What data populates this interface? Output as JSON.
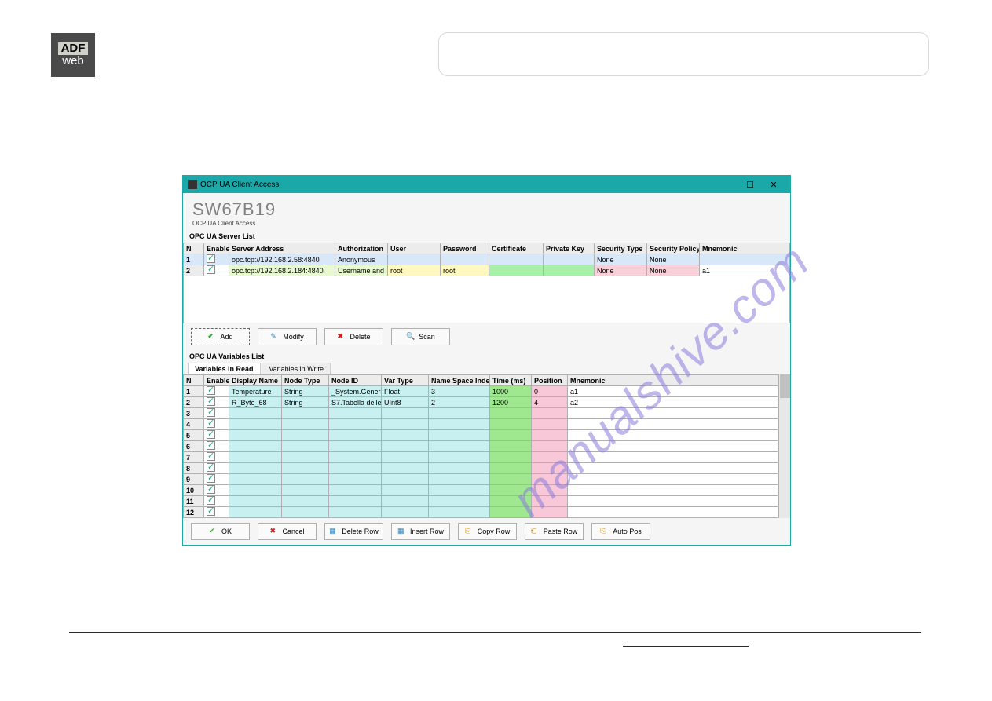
{
  "logo": {
    "top": "ADF",
    "bot": "web"
  },
  "watermark": "manualshive.com",
  "dialog": {
    "titlebar": "OCP UA Client Access",
    "app_title": "SW67B19",
    "app_sub": "OCP UA Client Access",
    "server_section": "OPC UA Server List",
    "vars_section": "OPC UA Variables List",
    "tabs": {
      "read": "Variables in Read",
      "write": "Variables in Write"
    },
    "server_headers": {
      "n": "N",
      "enable": "Enable",
      "address": "Server Address",
      "auth": "Authorization",
      "user": "User",
      "pass": "Password",
      "cert": "Certificate",
      "pkey": "Private Key",
      "sectype": "Security Type",
      "secpol": "Security Policy",
      "mnem": "Mnemonic"
    },
    "server_rows": [
      {
        "n": "1",
        "addr": "opc.tcp://192.168.2.58:4840",
        "auth": "Anonymous",
        "user": "",
        "pass": "",
        "cert": "",
        "pkey": "",
        "st": "None",
        "sp": "None",
        "mnem": ""
      },
      {
        "n": "2",
        "addr": "opc.tcp://192.168.2.184:4840",
        "auth": "Username and",
        "user": "root",
        "pass": "root",
        "cert": "",
        "pkey": "",
        "st": "None",
        "sp": "None",
        "mnem": "a1"
      }
    ],
    "var_headers": {
      "n": "N",
      "enable": "Enable",
      "disp": "Display Name",
      "ntype": "Node Type",
      "nid": "Node ID",
      "vtype": "Var Type",
      "nsidx": "Name Space Index",
      "time": "Time (ms)",
      "pos": "Position",
      "mnem": "Mnemonic"
    },
    "var_rows": [
      {
        "n": "1",
        "disp": "Temperature",
        "ntype": "String",
        "nid": "_System.General.T",
        "vtype": "Float",
        "ns": "3",
        "time": "1000",
        "pos": "0",
        "mnem": "a1"
      },
      {
        "n": "2",
        "disp": "R_Byte_68",
        "ntype": "String",
        "nid": "S7.Tabella delle",
        "vtype": "UInt8",
        "ns": "2",
        "time": "1200",
        "pos": "4",
        "mnem": "a2"
      },
      {
        "n": "3",
        "disp": "",
        "ntype": "",
        "nid": "",
        "vtype": "",
        "ns": "",
        "time": "",
        "pos": "",
        "mnem": ""
      },
      {
        "n": "4",
        "disp": "",
        "ntype": "",
        "nid": "",
        "vtype": "",
        "ns": "",
        "time": "",
        "pos": "",
        "mnem": ""
      },
      {
        "n": "5",
        "disp": "",
        "ntype": "",
        "nid": "",
        "vtype": "",
        "ns": "",
        "time": "",
        "pos": "",
        "mnem": ""
      },
      {
        "n": "6",
        "disp": "",
        "ntype": "",
        "nid": "",
        "vtype": "",
        "ns": "",
        "time": "",
        "pos": "",
        "mnem": ""
      },
      {
        "n": "7",
        "disp": "",
        "ntype": "",
        "nid": "",
        "vtype": "",
        "ns": "",
        "time": "",
        "pos": "",
        "mnem": ""
      },
      {
        "n": "8",
        "disp": "",
        "ntype": "",
        "nid": "",
        "vtype": "",
        "ns": "",
        "time": "",
        "pos": "",
        "mnem": ""
      },
      {
        "n": "9",
        "disp": "",
        "ntype": "",
        "nid": "",
        "vtype": "",
        "ns": "",
        "time": "",
        "pos": "",
        "mnem": ""
      },
      {
        "n": "10",
        "disp": "",
        "ntype": "",
        "nid": "",
        "vtype": "",
        "ns": "",
        "time": "",
        "pos": "",
        "mnem": ""
      },
      {
        "n": "11",
        "disp": "",
        "ntype": "",
        "nid": "",
        "vtype": "",
        "ns": "",
        "time": "",
        "pos": "",
        "mnem": ""
      },
      {
        "n": "12",
        "disp": "",
        "ntype": "",
        "nid": "",
        "vtype": "",
        "ns": "",
        "time": "",
        "pos": "",
        "mnem": ""
      }
    ],
    "buttons": {
      "add": "Add",
      "modify": "Modify",
      "delete": "Delete",
      "scan": "Scan",
      "ok": "OK",
      "cancel": "Cancel",
      "delrow": "Delete Row",
      "insrow": "Insert Row",
      "copyrow": "Copy Row",
      "pasterow": "Paste Row",
      "autopos": "Auto Pos"
    }
  }
}
